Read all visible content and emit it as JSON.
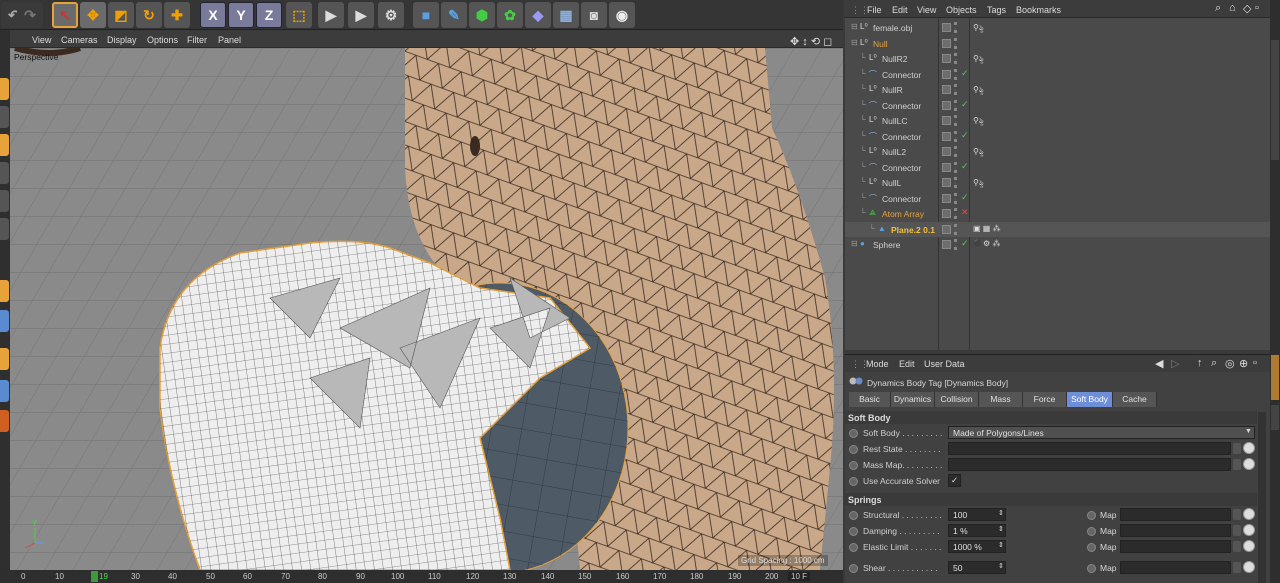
{
  "toolbar": {
    "icons": [
      "undo-icon",
      "redo-icon",
      "live-selection-icon",
      "move-icon",
      "scale-icon",
      "rotate-icon",
      "add-object-icon",
      "x-axis-lock",
      "y-axis-lock",
      "z-axis-lock",
      "coordinate-system-icon",
      "render-view-icon",
      "render-to-picture-viewer-icon",
      "render-settings-icon",
      "cube-icon",
      "pen-icon",
      "subdivision-icon",
      "cloner-icon",
      "deformer-icon",
      "floor-icon",
      "camera-icon",
      "light-icon"
    ],
    "x_label": "X",
    "y_label": "Y",
    "z_label": "Z"
  },
  "viewport": {
    "menu": [
      "View",
      "Cameras",
      "Display",
      "Options",
      "Filter",
      "Panel"
    ],
    "camera_label": "Perspective",
    "grid_spacing": "Grid Spacing : 1000 cm"
  },
  "timeline": {
    "ticks": [
      "0",
      "10",
      "19",
      "30",
      "40",
      "50",
      "60",
      "70",
      "80",
      "90",
      "100",
      "110",
      "120",
      "130",
      "140",
      "150",
      "160",
      "170",
      "180",
      "190",
      "200"
    ],
    "current_frame": "19",
    "end_field": "10 F"
  },
  "object_manager": {
    "menu": [
      "File",
      "Edit",
      "View",
      "Objects",
      "Tags",
      "Bookmarks"
    ],
    "objects": [
      {
        "name": "female.obj",
        "indent": 0,
        "type": "null",
        "color": "#d0d0d0",
        "tags": "poly-tag",
        "check": ""
      },
      {
        "name": "Null",
        "indent": 0,
        "type": "null",
        "color": "#e8a23a",
        "tags": "",
        "check": ""
      },
      {
        "name": "NullR2",
        "indent": 1,
        "type": "null",
        "color": "#d0d0d0",
        "tags": "dyn-tag",
        "check": ""
      },
      {
        "name": "Connector",
        "indent": 1,
        "type": "connector",
        "color": "#d0d0d0",
        "tags": "",
        "check": "✓"
      },
      {
        "name": "NullR",
        "indent": 1,
        "type": "null",
        "color": "#d0d0d0",
        "tags": "dyn-tag",
        "check": ""
      },
      {
        "name": "Connector",
        "indent": 1,
        "type": "connector",
        "color": "#d0d0d0",
        "tags": "",
        "check": "✓"
      },
      {
        "name": "NullLC",
        "indent": 1,
        "type": "null",
        "color": "#d0d0d0",
        "tags": "dyn-tag",
        "check": ""
      },
      {
        "name": "Connector",
        "indent": 1,
        "type": "connector",
        "color": "#d0d0d0",
        "tags": "",
        "check": "✓"
      },
      {
        "name": "NullL2",
        "indent": 1,
        "type": "null",
        "color": "#d0d0d0",
        "tags": "dyn-tag",
        "check": ""
      },
      {
        "name": "Connector",
        "indent": 1,
        "type": "connector",
        "color": "#d0d0d0",
        "tags": "",
        "check": "✓"
      },
      {
        "name": "NullL",
        "indent": 1,
        "type": "null",
        "color": "#d0d0d0",
        "tags": "dyn-tag",
        "check": ""
      },
      {
        "name": "Connector",
        "indent": 1,
        "type": "connector",
        "color": "#d0d0d0",
        "tags": "",
        "check": "✓"
      },
      {
        "name": "Atom Array",
        "indent": 1,
        "type": "atom",
        "color": "#e8a23a",
        "tags": "",
        "check": "✕"
      },
      {
        "name": "Plane.2 0.1",
        "indent": 2,
        "type": "plane",
        "color": "#f0c040",
        "tags": "plane-tags",
        "check": ""
      },
      {
        "name": "Sphere",
        "indent": 0,
        "type": "sphere",
        "color": "#d0d0d0",
        "tags": "sphere-tags",
        "check": "✓"
      }
    ]
  },
  "attribute_manager": {
    "menu": [
      "Mode",
      "Edit",
      "User Data"
    ],
    "title": "Dynamics Body Tag [Dynamics Body]",
    "tabs": [
      "Basic",
      "Dynamics",
      "Collision",
      "Mass",
      "Force",
      "Soft Body",
      "Cache"
    ],
    "active_tab": "Soft Body",
    "soft_body_section": "Soft Body",
    "soft_body": {
      "label": "Soft Body . . . . . . . . .",
      "value": "Made of Polygons/Lines"
    },
    "rest_state": {
      "label": "Rest State  . . . . . . . .",
      "value": ""
    },
    "mass_map": {
      "label": "Mass Map. . . . . . . . .",
      "value": ""
    },
    "use_accurate_solver": {
      "label": "Use Accurate Solver",
      "value": "✓"
    },
    "springs_section": "Springs",
    "structural": {
      "label": "Structural . . . . . . . . .",
      "value": "100",
      "map_label": "Map"
    },
    "damping": {
      "label": "Damping . . . . . . . . .",
      "value": "1 %",
      "map_label": "Map"
    },
    "elastic_limit": {
      "label": "Elastic Limit . . . . . . .",
      "value": "1000 %",
      "map_label": "Map"
    },
    "shear": {
      "label": "Shear . . . . . . . . . . .",
      "value": "50",
      "map_label": "Map"
    }
  },
  "colors": {
    "accent": "#e8a23a",
    "active_tab": "#6e8fd8",
    "bg": "#3a3a3a"
  }
}
